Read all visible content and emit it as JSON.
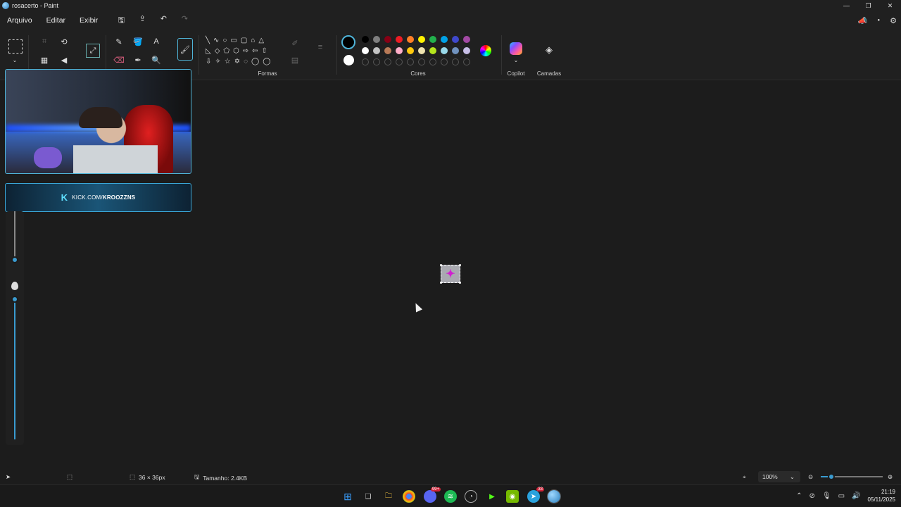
{
  "window": {
    "title": "rosacerto - Paint",
    "buttons": [
      "—",
      "❐",
      "✕"
    ]
  },
  "menu": {
    "items": [
      "Arquivo",
      "Editar",
      "Exibir"
    ]
  },
  "ribbon": {
    "groups": {
      "shapes_label": "Formas",
      "colors_label": "Cores",
      "copilot_label": "Copilot",
      "layers_label": "Camadas"
    },
    "palette_row1": [
      "#000000",
      "#7f7f7f",
      "#880015",
      "#ed1c24",
      "#ff7f27",
      "#fff200",
      "#22b14c",
      "#00a2e8",
      "#3f48cc",
      "#a349a4"
    ],
    "palette_row2": [
      "#ffffff",
      "#c3c3c3",
      "#b97a57",
      "#ffaec9",
      "#ffc90e",
      "#efe4b0",
      "#b5e61d",
      "#99d9ea",
      "#7092be",
      "#c8bfe7"
    ],
    "primary_color": "#000000",
    "secondary_color": "#ffffff"
  },
  "overlay": {
    "kick_prefix": "KICK.COM/",
    "kick_user": "KROOZZNS",
    "kick_k": "K"
  },
  "status": {
    "canvas_size": "36 × 36px",
    "file_size": "Tamanho: 2.4KB",
    "zoom": "100%"
  },
  "taskbar": {
    "time": "21:19",
    "date": "05/11/2025",
    "discord_badge": "99+",
    "telegram_badge": "33"
  }
}
